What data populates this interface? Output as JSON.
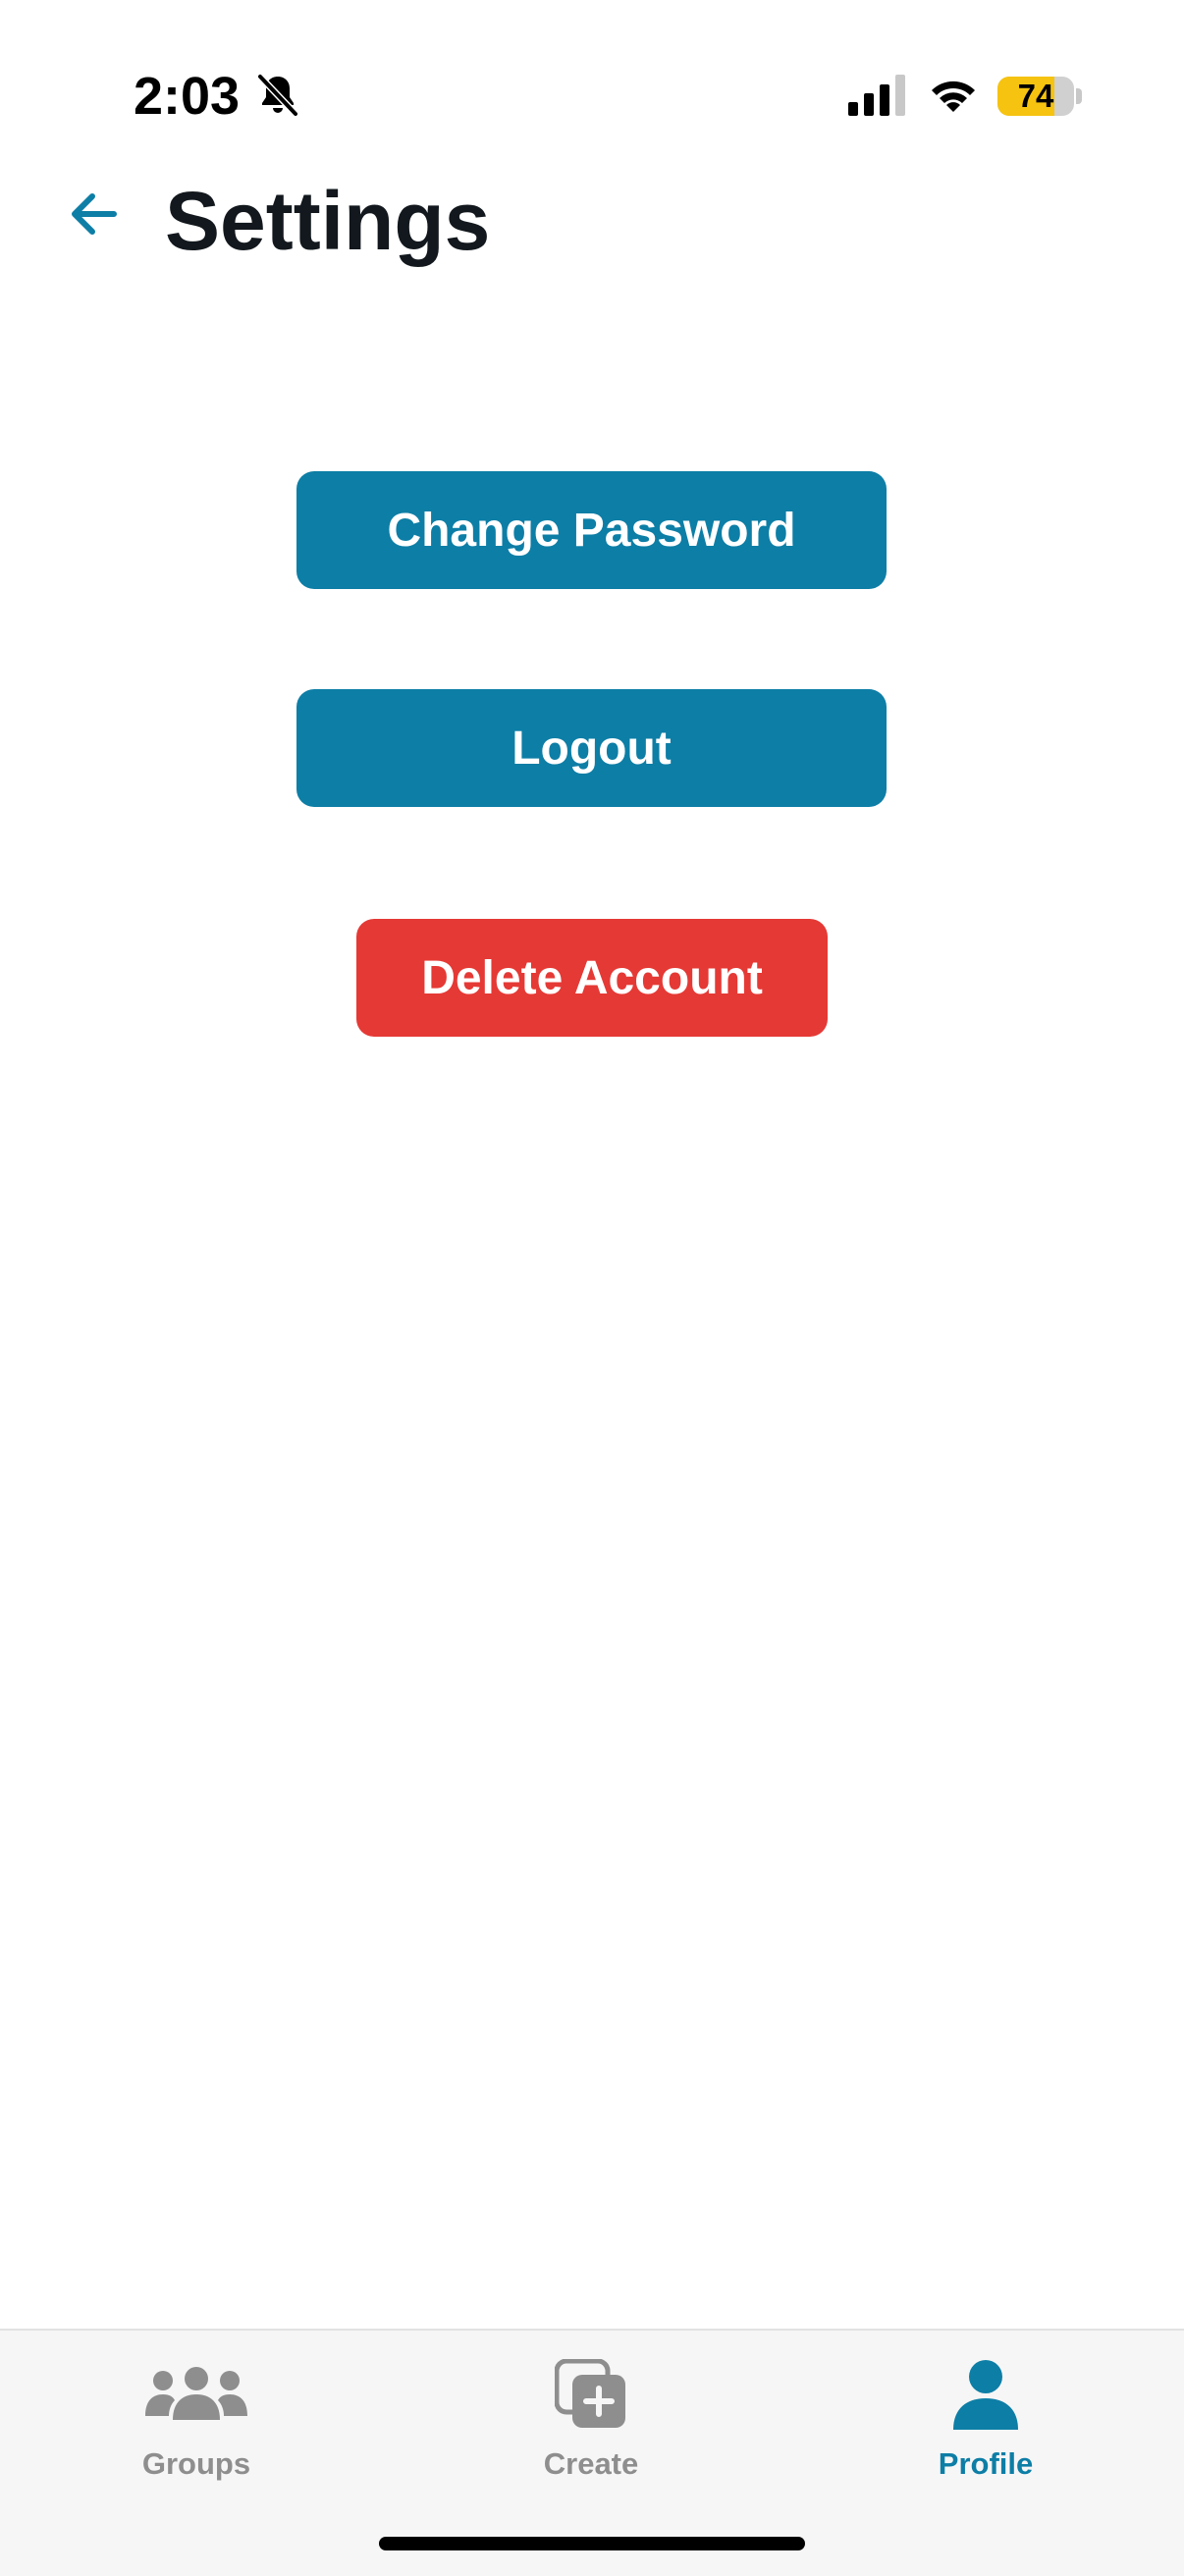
{
  "status_bar": {
    "time": "2:03",
    "battery_level": 74,
    "battery_text": "74",
    "icons": [
      "bell-slash-icon",
      "cellular-signal-icon",
      "wifi-icon",
      "battery-icon"
    ]
  },
  "header": {
    "title": "Settings",
    "back_icon": "arrow-left-icon"
  },
  "buttons": {
    "change_password": "Change Password",
    "logout": "Logout",
    "delete_account": "Delete Account"
  },
  "tabs": [
    {
      "label": "Groups",
      "icon": "groups-icon",
      "active": false
    },
    {
      "label": "Create",
      "icon": "create-icon",
      "active": false
    },
    {
      "label": "Profile",
      "icon": "profile-icon",
      "active": true
    }
  ],
  "colors": {
    "accent": "#0d7ea6",
    "danger": "#e53935",
    "inactive_tab": "#8e8e8e",
    "battery": "#f6c310"
  }
}
